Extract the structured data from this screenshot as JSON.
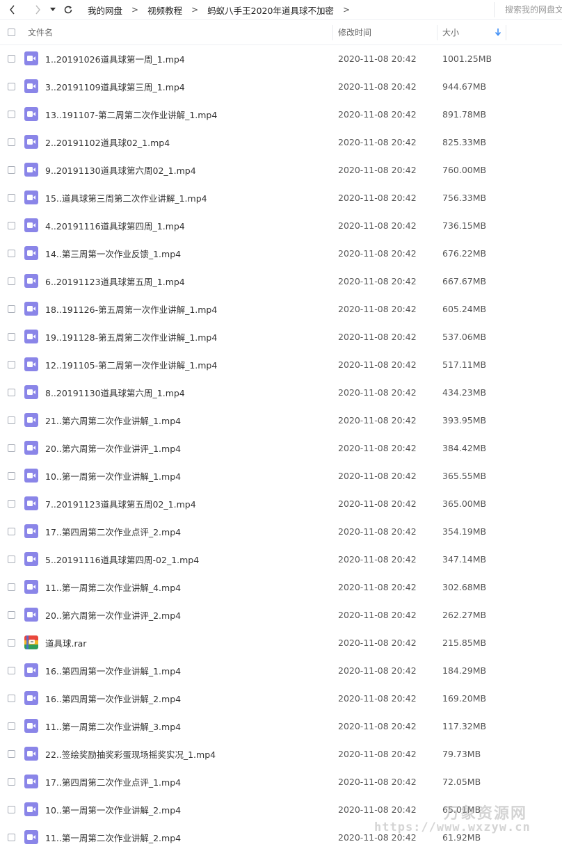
{
  "breadcrumb": [
    "我的网盘",
    "视频教程",
    "蚂蚁八手王2020年道具球不加密"
  ],
  "breadcrumb_separator": ">",
  "search": {
    "placeholder": "搜索我的网盘文件"
  },
  "table": {
    "headers": {
      "name": "文件名",
      "modified": "修改时间",
      "size": "大小"
    },
    "rows": [
      {
        "type": "video",
        "name": "1..20191026道具球第一周_1.mp4",
        "modified": "2020-11-08 20:42",
        "size": "1001.25MB"
      },
      {
        "type": "video",
        "name": "3..20191109道具球第三周_1.mp4",
        "modified": "2020-11-08 20:42",
        "size": "944.67MB"
      },
      {
        "type": "video",
        "name": "13..191107-第二周第二次作业讲解_1.mp4",
        "modified": "2020-11-08 20:42",
        "size": "891.78MB"
      },
      {
        "type": "video",
        "name": "2..20191102道具球02_1.mp4",
        "modified": "2020-11-08 20:42",
        "size": "825.33MB"
      },
      {
        "type": "video",
        "name": "9..20191130道具球第六周02_1.mp4",
        "modified": "2020-11-08 20:42",
        "size": "760.00MB"
      },
      {
        "type": "video",
        "name": "15..道具球第三周第二次作业讲解_1.mp4",
        "modified": "2020-11-08 20:42",
        "size": "756.33MB"
      },
      {
        "type": "video",
        "name": "4..20191116道具球第四周_1.mp4",
        "modified": "2020-11-08 20:42",
        "size": "736.15MB"
      },
      {
        "type": "video",
        "name": "14..第三周第一次作业反馈_1.mp4",
        "modified": "2020-11-08 20:42",
        "size": "676.22MB"
      },
      {
        "type": "video",
        "name": "6..20191123道具球第五周_1.mp4",
        "modified": "2020-11-08 20:42",
        "size": "667.67MB"
      },
      {
        "type": "video",
        "name": "18..191126-第五周第一次作业讲解_1.mp4",
        "modified": "2020-11-08 20:42",
        "size": "605.24MB"
      },
      {
        "type": "video",
        "name": "19..191128-第五周第二次作业讲解_1.mp4",
        "modified": "2020-11-08 20:42",
        "size": "537.06MB"
      },
      {
        "type": "video",
        "name": "12..191105-第二周第一次作业讲解_1.mp4",
        "modified": "2020-11-08 20:42",
        "size": "517.11MB"
      },
      {
        "type": "video",
        "name": "8..20191130道具球第六周_1.mp4",
        "modified": "2020-11-08 20:42",
        "size": "434.23MB"
      },
      {
        "type": "video",
        "name": "21..第六周第二次作业讲解_1.mp4",
        "modified": "2020-11-08 20:42",
        "size": "393.95MB"
      },
      {
        "type": "video",
        "name": "20..第六周第一次作业讲评_1.mp4",
        "modified": "2020-11-08 20:42",
        "size": "384.42MB"
      },
      {
        "type": "video",
        "name": "10..第一周第一次作业讲解_1.mp4",
        "modified": "2020-11-08 20:42",
        "size": "365.55MB"
      },
      {
        "type": "video",
        "name": "7..20191123道具球第五周02_1.mp4",
        "modified": "2020-11-08 20:42",
        "size": "365.00MB"
      },
      {
        "type": "video",
        "name": "17..第四周第二次作业点评_2.mp4",
        "modified": "2020-11-08 20:42",
        "size": "354.19MB"
      },
      {
        "type": "video",
        "name": "5..20191116道具球第四周-02_1.mp4",
        "modified": "2020-11-08 20:42",
        "size": "347.14MB"
      },
      {
        "type": "video",
        "name": "11..第一周第二次作业讲解_4.mp4",
        "modified": "2020-11-08 20:42",
        "size": "302.68MB"
      },
      {
        "type": "video",
        "name": "20..第六周第一次作业讲评_2.mp4",
        "modified": "2020-11-08 20:42",
        "size": "262.27MB"
      },
      {
        "type": "archive",
        "name": "道具球.rar",
        "modified": "2020-11-08 20:42",
        "size": "215.85MB"
      },
      {
        "type": "video",
        "name": "16..第四周第一次作业讲解_1.mp4",
        "modified": "2020-11-08 20:42",
        "size": "184.29MB"
      },
      {
        "type": "video",
        "name": "16..第四周第一次作业讲解_2.mp4",
        "modified": "2020-11-08 20:42",
        "size": "169.20MB"
      },
      {
        "type": "video",
        "name": "11..第一周第二次作业讲解_3.mp4",
        "modified": "2020-11-08 20:42",
        "size": "117.32MB"
      },
      {
        "type": "video",
        "name": "22..签绘奖励抽奖彩蛋现场摇奖实况_1.mp4",
        "modified": "2020-11-08 20:42",
        "size": "79.73MB"
      },
      {
        "type": "video",
        "name": "17..第四周第二次作业点评_1.mp4",
        "modified": "2020-11-08 20:42",
        "size": "72.05MB"
      },
      {
        "type": "video",
        "name": "10..第一周第一次作业讲解_2.mp4",
        "modified": "2020-11-08 20:42",
        "size": "65.01MB"
      },
      {
        "type": "video",
        "name": "11..第一周第二次作业讲解_2.mp4",
        "modified": "2020-11-08 20:42",
        "size": "61.92MB"
      }
    ]
  },
  "watermark": {
    "title": "万象资源网",
    "url": "https://www.wxzyw.cn"
  },
  "colors": {
    "video_icon": "#8a85e8",
    "sort_arrow": "#3b8cf5"
  }
}
